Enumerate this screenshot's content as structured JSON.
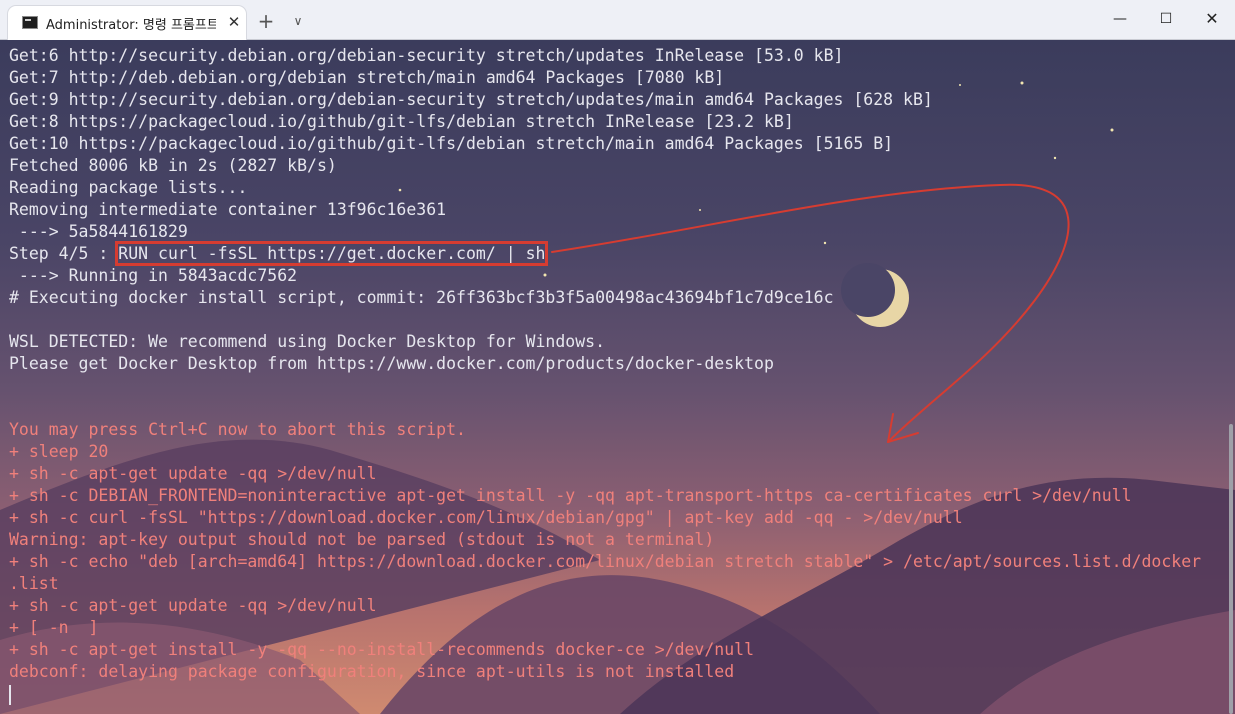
{
  "window": {
    "tab_title": "Administrator: 명령 프롬프트 - ",
    "tab_close_glyph": "✕",
    "new_tab_glyph": "+",
    "dropdown_glyph": "∨",
    "minimize_glyph": "—",
    "maximize_glyph": "☐",
    "close_glyph": "✕",
    "tab_icon": "command-prompt-icon"
  },
  "terminal": {
    "lines": [
      {
        "text": "Get:6 http://security.debian.org/debian-security stretch/updates InRelease [53.0 kB]",
        "red": false
      },
      {
        "text": "Get:7 http://deb.debian.org/debian stretch/main amd64 Packages [7080 kB]",
        "red": false
      },
      {
        "text": "Get:9 http://security.debian.org/debian-security stretch/updates/main amd64 Packages [628 kB]",
        "red": false
      },
      {
        "text": "Get:8 https://packagecloud.io/github/git-lfs/debian stretch InRelease [23.2 kB]",
        "red": false
      },
      {
        "text": "Get:10 https://packagecloud.io/github/git-lfs/debian stretch/main amd64 Packages [5165 B]",
        "red": false
      },
      {
        "text": "Fetched 8006 kB in 2s (2827 kB/s)",
        "red": false
      },
      {
        "text": "Reading package lists...",
        "red": false
      },
      {
        "text": "Removing intermediate container 13f96c16e361",
        "red": false
      },
      {
        "text": " ---> 5a5844161829",
        "red": false
      },
      {
        "text": "Step 4/5 : ",
        "highlight": "RUN curl -fsSL https://get.docker.com/ | sh",
        "red": false
      },
      {
        "text": " ---> Running in 5843acdc7562",
        "red": false
      },
      {
        "text": "# Executing docker install script, commit: 26ff363bcf3b3f5a00498ac43694bf1c7d9ce16c",
        "red": false
      },
      {
        "text": "",
        "red": false
      },
      {
        "text": "WSL DETECTED: We recommend using Docker Desktop for Windows.",
        "red": false
      },
      {
        "text": "Please get Docker Desktop from https://www.docker.com/products/docker-desktop",
        "red": false
      },
      {
        "text": "",
        "red": false
      },
      {
        "text": "",
        "red": false
      },
      {
        "text": "You may press Ctrl+C now to abort this script.",
        "red": true
      },
      {
        "text": "+ sleep 20",
        "red": true
      },
      {
        "text": "+ sh -c apt-get update -qq >/dev/null",
        "red": true
      },
      {
        "text": "+ sh -c DEBIAN_FRONTEND=noninteractive apt-get install -y -qq apt-transport-https ca-certificates curl >/dev/null",
        "red": true
      },
      {
        "text": "+ sh -c curl -fsSL \"https://download.docker.com/linux/debian/gpg\" | apt-key add -qq - >/dev/null",
        "red": true
      },
      {
        "text": "Warning: apt-key output should not be parsed (stdout is not a terminal)",
        "red": true
      },
      {
        "text": "+ sh -c echo \"deb [arch=amd64] https://download.docker.com/linux/debian stretch stable\" > /etc/apt/sources.list.d/docker",
        "red": true
      },
      {
        "text": ".list",
        "red": true
      },
      {
        "text": "+ sh -c apt-get update -qq >/dev/null",
        "red": true
      },
      {
        "text": "+ [ -n  ]",
        "red": true
      },
      {
        "text": "+ sh -c apt-get install -y -qq --no-install-recommends docker-ce >/dev/null",
        "red": true
      },
      {
        "text": "debconf: delaying package configuration, since apt-utils is not installed",
        "red": true
      }
    ]
  },
  "colors": {
    "terminal_text": "#e6e6ee",
    "error_text": "#f0807b",
    "annotation_red": "#d63c31"
  }
}
